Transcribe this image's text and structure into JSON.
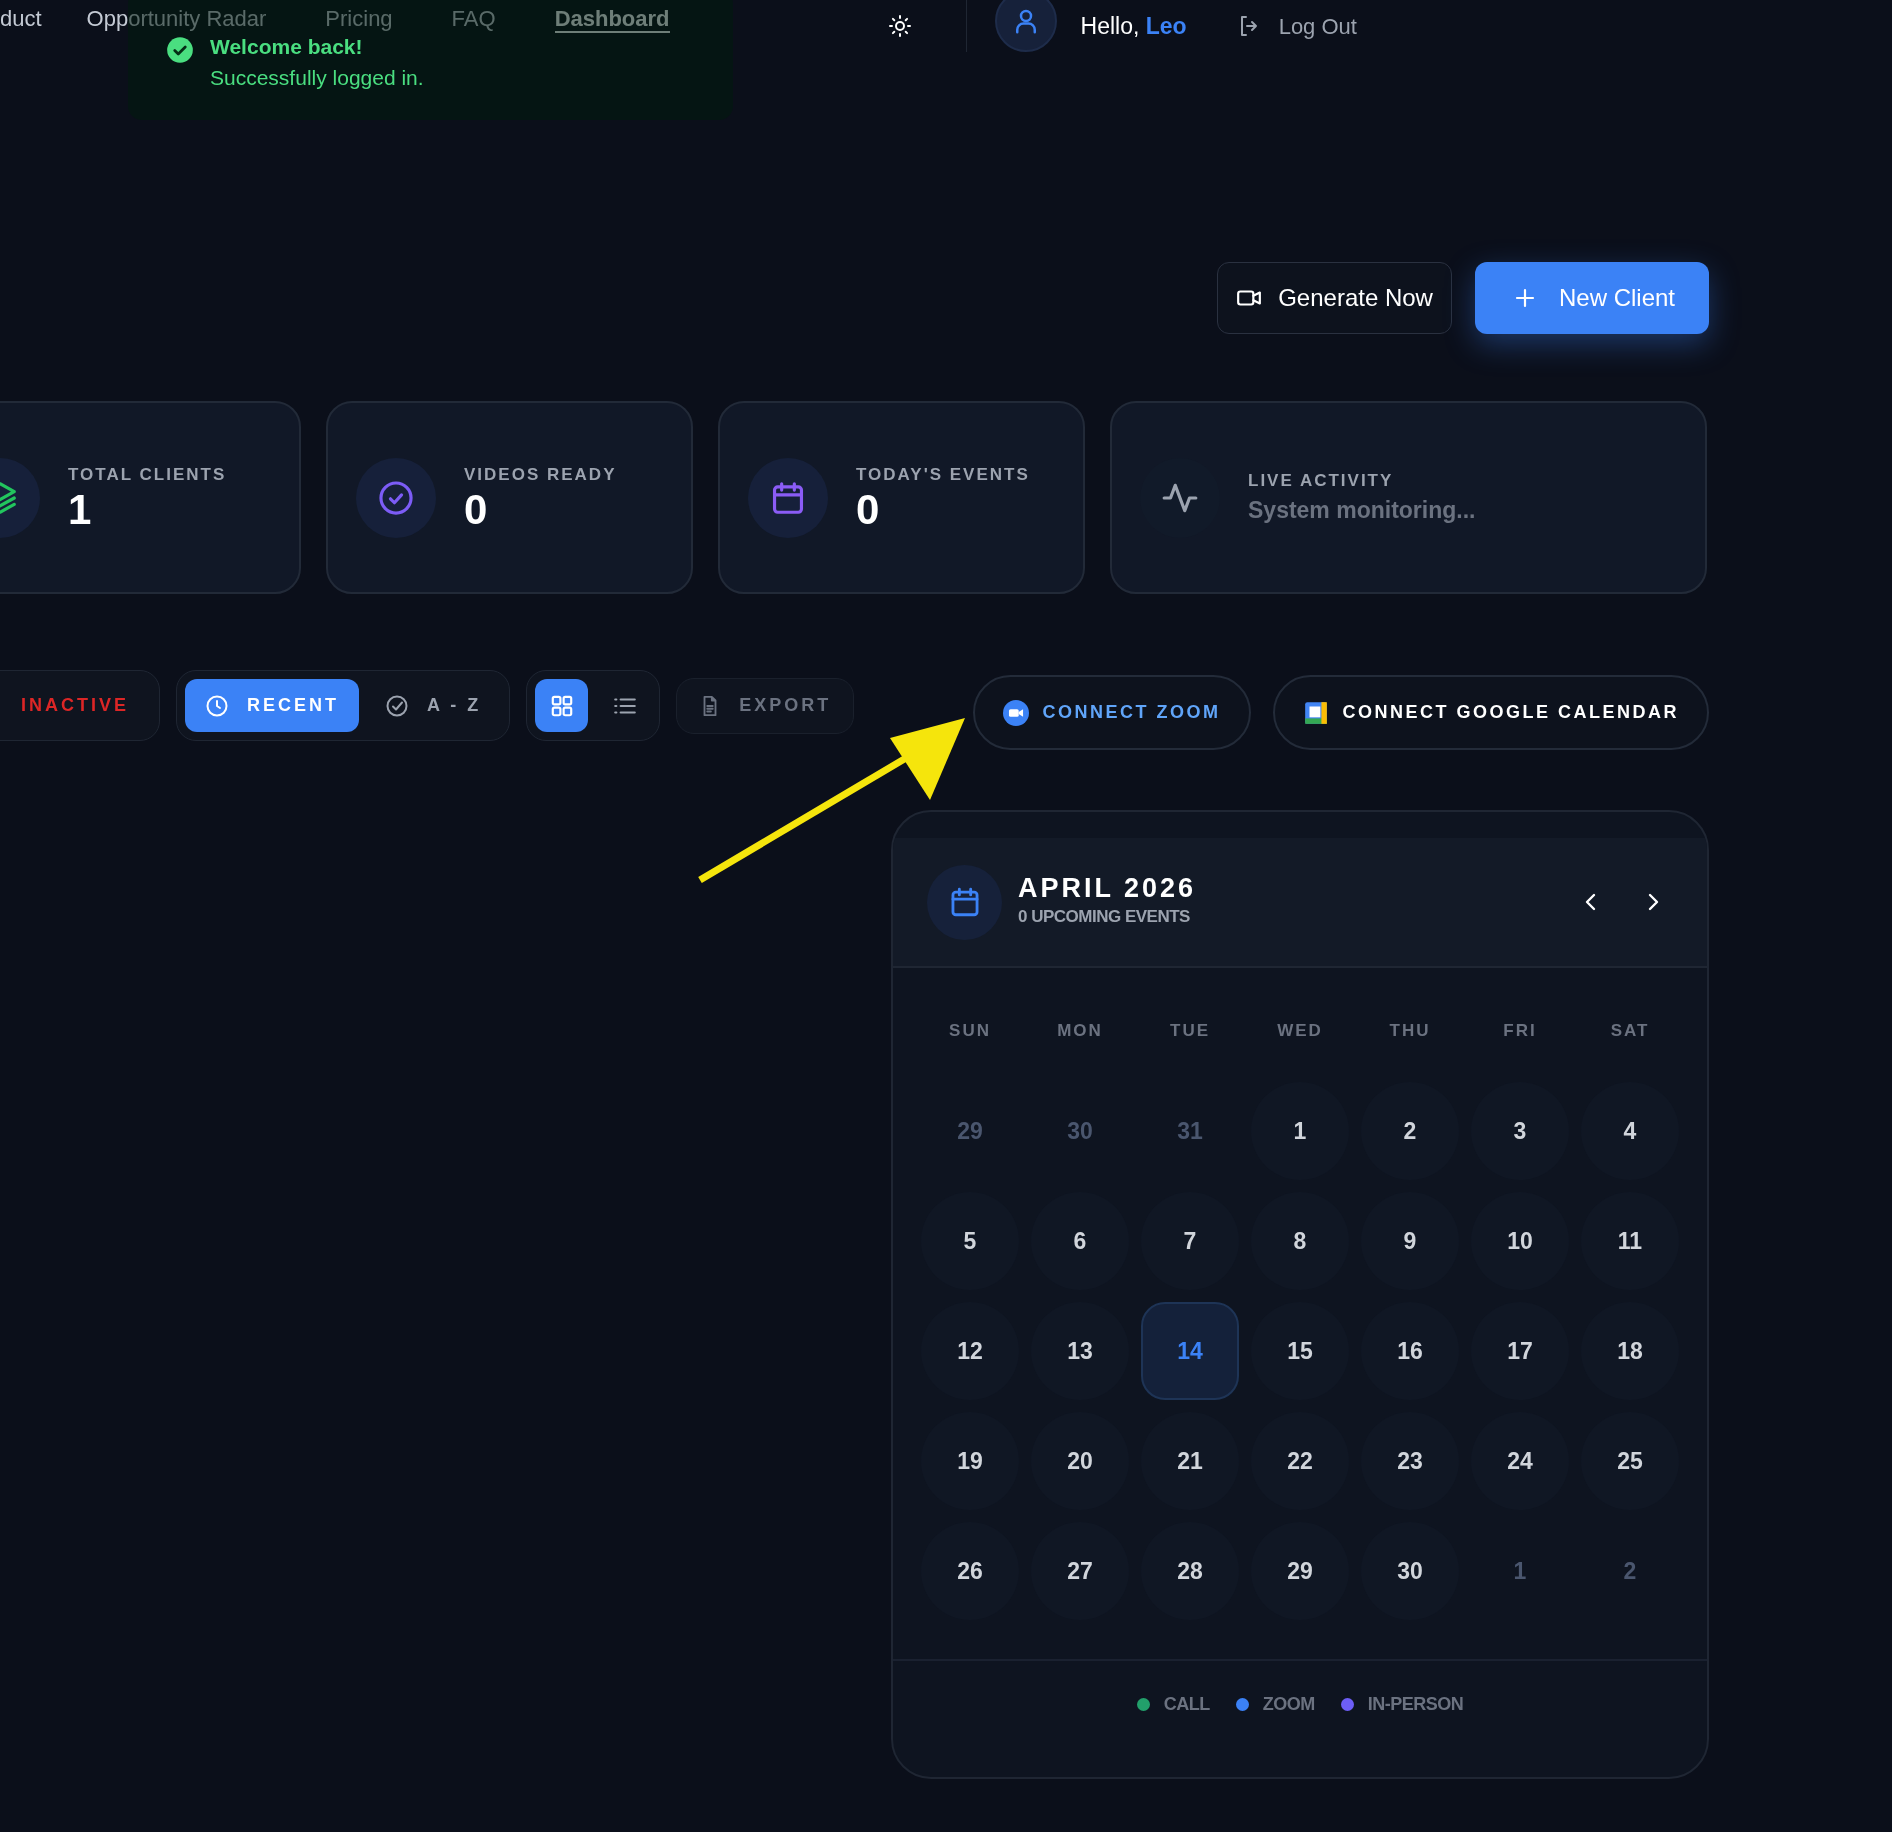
{
  "nav": {
    "items": [
      {
        "label": "duct",
        "selected": false
      },
      {
        "label": "Opportunity Radar",
        "selected": false
      },
      {
        "label": "Pricing",
        "selected": false
      },
      {
        "label": "FAQ",
        "selected": false
      },
      {
        "label": "Dashboard",
        "selected": true
      }
    ]
  },
  "toast": {
    "title": "Welcome back!",
    "message": "Successfully logged in."
  },
  "user": {
    "greeting": "Hello,",
    "name": "Leo",
    "logout": "Log Out"
  },
  "actions": [
    {
      "label": "Generate Now",
      "kind": "secondary"
    },
    {
      "label": "New Client",
      "kind": "primary"
    }
  ],
  "stats": [
    {
      "kind": "clients",
      "label": "TOTAL CLIENTS",
      "value": "1"
    },
    {
      "kind": "videos",
      "label": "VIDEOS READY",
      "value": "0"
    },
    {
      "kind": "events",
      "label": "TODAY'S EVENTS",
      "value": "0"
    },
    {
      "kind": "activity",
      "label": "LIVE ACTIVITY",
      "subtitle": "System monitoring..."
    }
  ],
  "filters": {
    "status": "INACTIVE",
    "sort": [
      {
        "label": "RECENT",
        "kind": "recent",
        "selected": true
      },
      {
        "label": "A - Z",
        "kind": "az",
        "selected": false
      }
    ],
    "views": [
      {
        "kind": "grid",
        "selected": true
      },
      {
        "kind": "list",
        "selected": false
      }
    ],
    "export": "EXPORT"
  },
  "integrations": [
    {
      "kind": "zoom",
      "label": "CONNECT ZOOM"
    },
    {
      "kind": "google",
      "label": "CONNECT GOOGLE CALENDAR"
    }
  ],
  "calendar": {
    "title": "APRIL 2026",
    "subtitle": "0 UPCOMING EVENTS",
    "weekdays": [
      "SUN",
      "MON",
      "TUE",
      "WED",
      "THU",
      "FRI",
      "SAT"
    ],
    "days": [
      {
        "label": "29",
        "outside": true,
        "selected": false
      },
      {
        "label": "30",
        "outside": true,
        "selected": false
      },
      {
        "label": "31",
        "outside": true,
        "selected": false
      },
      {
        "label": "1",
        "outside": false,
        "selected": false
      },
      {
        "label": "2",
        "outside": false,
        "selected": false
      },
      {
        "label": "3",
        "outside": false,
        "selected": false
      },
      {
        "label": "4",
        "outside": false,
        "selected": false
      },
      {
        "label": "5",
        "outside": false,
        "selected": false
      },
      {
        "label": "6",
        "outside": false,
        "selected": false
      },
      {
        "label": "7",
        "outside": false,
        "selected": false
      },
      {
        "label": "8",
        "outside": false,
        "selected": false
      },
      {
        "label": "9",
        "outside": false,
        "selected": false
      },
      {
        "label": "10",
        "outside": false,
        "selected": false
      },
      {
        "label": "11",
        "outside": false,
        "selected": false
      },
      {
        "label": "12",
        "outside": false,
        "selected": false
      },
      {
        "label": "13",
        "outside": false,
        "selected": false
      },
      {
        "label": "14",
        "outside": false,
        "selected": true
      },
      {
        "label": "15",
        "outside": false,
        "selected": false
      },
      {
        "label": "16",
        "outside": false,
        "selected": false
      },
      {
        "label": "17",
        "outside": false,
        "selected": false
      },
      {
        "label": "18",
        "outside": false,
        "selected": false
      },
      {
        "label": "19",
        "outside": false,
        "selected": false
      },
      {
        "label": "20",
        "outside": false,
        "selected": false
      },
      {
        "label": "21",
        "outside": false,
        "selected": false
      },
      {
        "label": "22",
        "outside": false,
        "selected": false
      },
      {
        "label": "23",
        "outside": false,
        "selected": false
      },
      {
        "label": "24",
        "outside": false,
        "selected": false
      },
      {
        "label": "25",
        "outside": false,
        "selected": false
      },
      {
        "label": "26",
        "outside": false,
        "selected": false
      },
      {
        "label": "27",
        "outside": false,
        "selected": false
      },
      {
        "label": "28",
        "outside": false,
        "selected": false
      },
      {
        "label": "29",
        "outside": false,
        "selected": false
      },
      {
        "label": "30",
        "outside": false,
        "selected": false
      },
      {
        "label": "1",
        "outside": true,
        "selected": false
      },
      {
        "label": "2",
        "outside": true,
        "selected": false
      }
    ],
    "legend": [
      {
        "label": "CALL",
        "color": "#22a06b"
      },
      {
        "label": "ZOOM",
        "color": "#3b82f6"
      },
      {
        "label": "IN-PERSON",
        "color": "#6d5ef6"
      }
    ]
  }
}
